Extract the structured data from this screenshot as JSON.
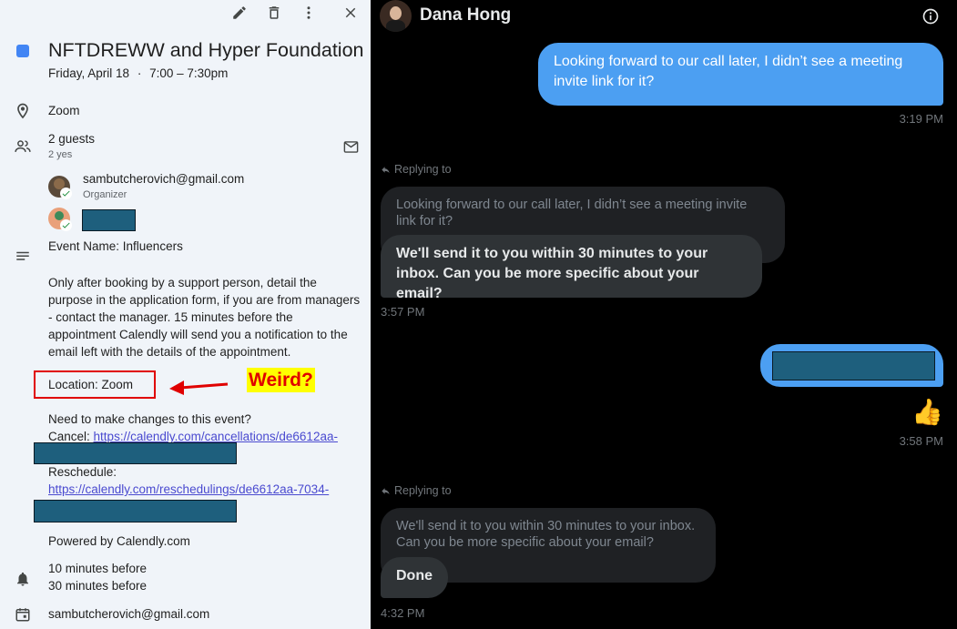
{
  "event": {
    "title": "NFTDREWW and Hyper Foundation",
    "date": "Friday, April 18",
    "time_sep": "·",
    "time": "7:00 – 7:30pm",
    "location": "Zoom",
    "guests_count": "2 guests",
    "guests_yes": "2 yes",
    "organizer_email": "sambutcherovich@gmail.com",
    "organizer_role": "Organizer",
    "description": {
      "event_name": "Event Name: Influencers",
      "body": "Only after booking by a support person, detail the purpose in the application form, if you are from managers - contact the manager. 15 minutes before the appointment Calendly will send you a notification to the email left with the details of the appointment.",
      "location_line": "Location: Zoom",
      "changes_heading": "Need to make changes to this event?",
      "cancel_label": "Cancel:",
      "cancel_link": "https://calendly.com/cancellations/de6612aa-",
      "reschedule_label": "Reschedule:",
      "reschedule_link": "https://calendly.com/reschedulings/de6612aa-7034-",
      "powered": "Powered by Calendly.com"
    },
    "reminders": [
      "10 minutes before",
      "30 minutes before"
    ],
    "calendar_owner": "sambutcherovich@gmail.com",
    "annotation": "Weird?"
  },
  "chat": {
    "contact_name": "Dana Hong",
    "messages": {
      "m1": "Looking forward to our call later, I didn’t see a meeting invite link for it?",
      "m1_time": "3:19 PM",
      "reply_label": "Replying to",
      "q1": "Looking forward to our call later, I didn’t see a meeting invite link for it?",
      "r1": "We'll send it to you within 30 minutes to your inbox. Can you be more specific about your email?",
      "r1_time": "3:57 PM",
      "m2_time": "3:58 PM",
      "thumbs": "👍",
      "q2": "We'll send it to you within 30 minutes to your inbox. Can you be more specific about your email?",
      "r2": "Done",
      "r2_time": "4:32 PM"
    }
  },
  "colors": {
    "calendar_chip": "#4285f4",
    "sent_bubble": "#4c9ff2",
    "received_bubble": "#2f3336",
    "annotation_red": "#e00000",
    "annotation_yellow": "#ffff00",
    "redaction": "#1e5f7d"
  }
}
